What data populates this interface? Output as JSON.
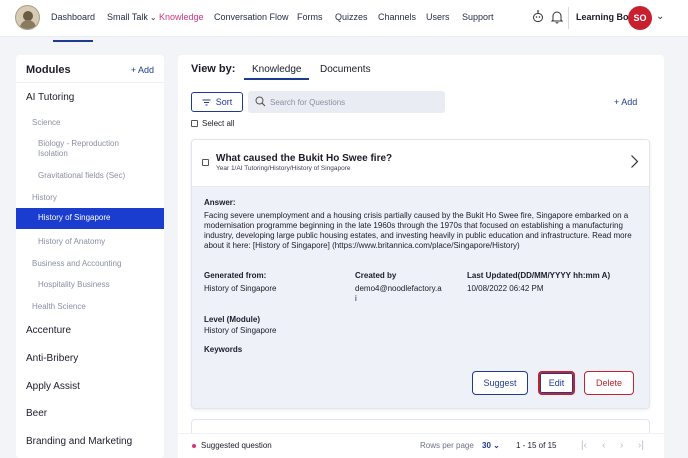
{
  "nav": {
    "items": [
      "Dashboard",
      "Small Talk",
      "Knowledge",
      "Conversation Flow",
      "Forms",
      "Quizzes",
      "Channels",
      "Users",
      "Support"
    ],
    "active": "Knowledge",
    "bot_name": "Learning Bot",
    "avatar_initials": "SO",
    "icons": [
      "robot-icon",
      "bell-icon",
      "chevron-down-icon"
    ]
  },
  "sidebar": {
    "title": "Modules",
    "add_label": "+ Add",
    "items": [
      "AI Tutoring",
      "Science",
      "Biology - Reproduction Isolation",
      "Gravitational fields (Sec)",
      "History",
      "History of Singapore",
      "History of Anatomy",
      "Business and Accounting",
      "Hospitality Business",
      "Health Science",
      "Accenture",
      "Anti-Bribery",
      "Apply Assist",
      "Beer",
      "Branding and Marketing"
    ],
    "selected": "History of Singapore"
  },
  "main": {
    "view_by_label": "View by:",
    "tabs": [
      "Knowledge",
      "Documents"
    ],
    "active_tab": "Knowledge",
    "sort_label": "Sort",
    "search_placeholder": "Search for Questions",
    "add_label": "+ Add",
    "select_all_label": "Select all"
  },
  "question": {
    "title": "What caused the Bukit Ho Swee fire?",
    "path": "Year 1/AI Tutoring/History/History of Singapore",
    "answer_label": "Answer:",
    "answer_text": "Facing severe unemployment and a housing crisis partially caused by the Bukit Ho Swee fire, Singapore embarked on a modernisation programme beginning in the late 1960s through the 1970s that focused on establishing a manufacturing industry, developing large public housing estates, and investing heavily in public education and infrastructure. Read more about it here: [History of Singapore] (https://www.britannica.com/place/Singapore/History)",
    "generated_from_label": "Generated from:",
    "generated_from": "History of Singapore",
    "created_by_label": "Created by",
    "created_by_line1": "demo4@noodlefactory.a",
    "created_by_line2": "i",
    "last_updated_label": "Last Updated(DD/MM/YYYY hh:mm A)",
    "last_updated": "10/08/2022 06:42 PM",
    "level_label": "Level (Module)",
    "level": "History of Singapore",
    "keywords_label": "Keywords",
    "suggest_label": "Suggest",
    "edit_label": "Edit",
    "delete_label": "Delete"
  },
  "footer": {
    "legend": "Suggested question",
    "rows_per_page_label": "Rows per page",
    "rows_per_page": "30",
    "range": "1 - 15 of 15"
  },
  "colors": {
    "accent": "#1f3b8f",
    "selected": "#1a3ccf",
    "pink": "#d7357d",
    "danger": "#c2232d"
  }
}
